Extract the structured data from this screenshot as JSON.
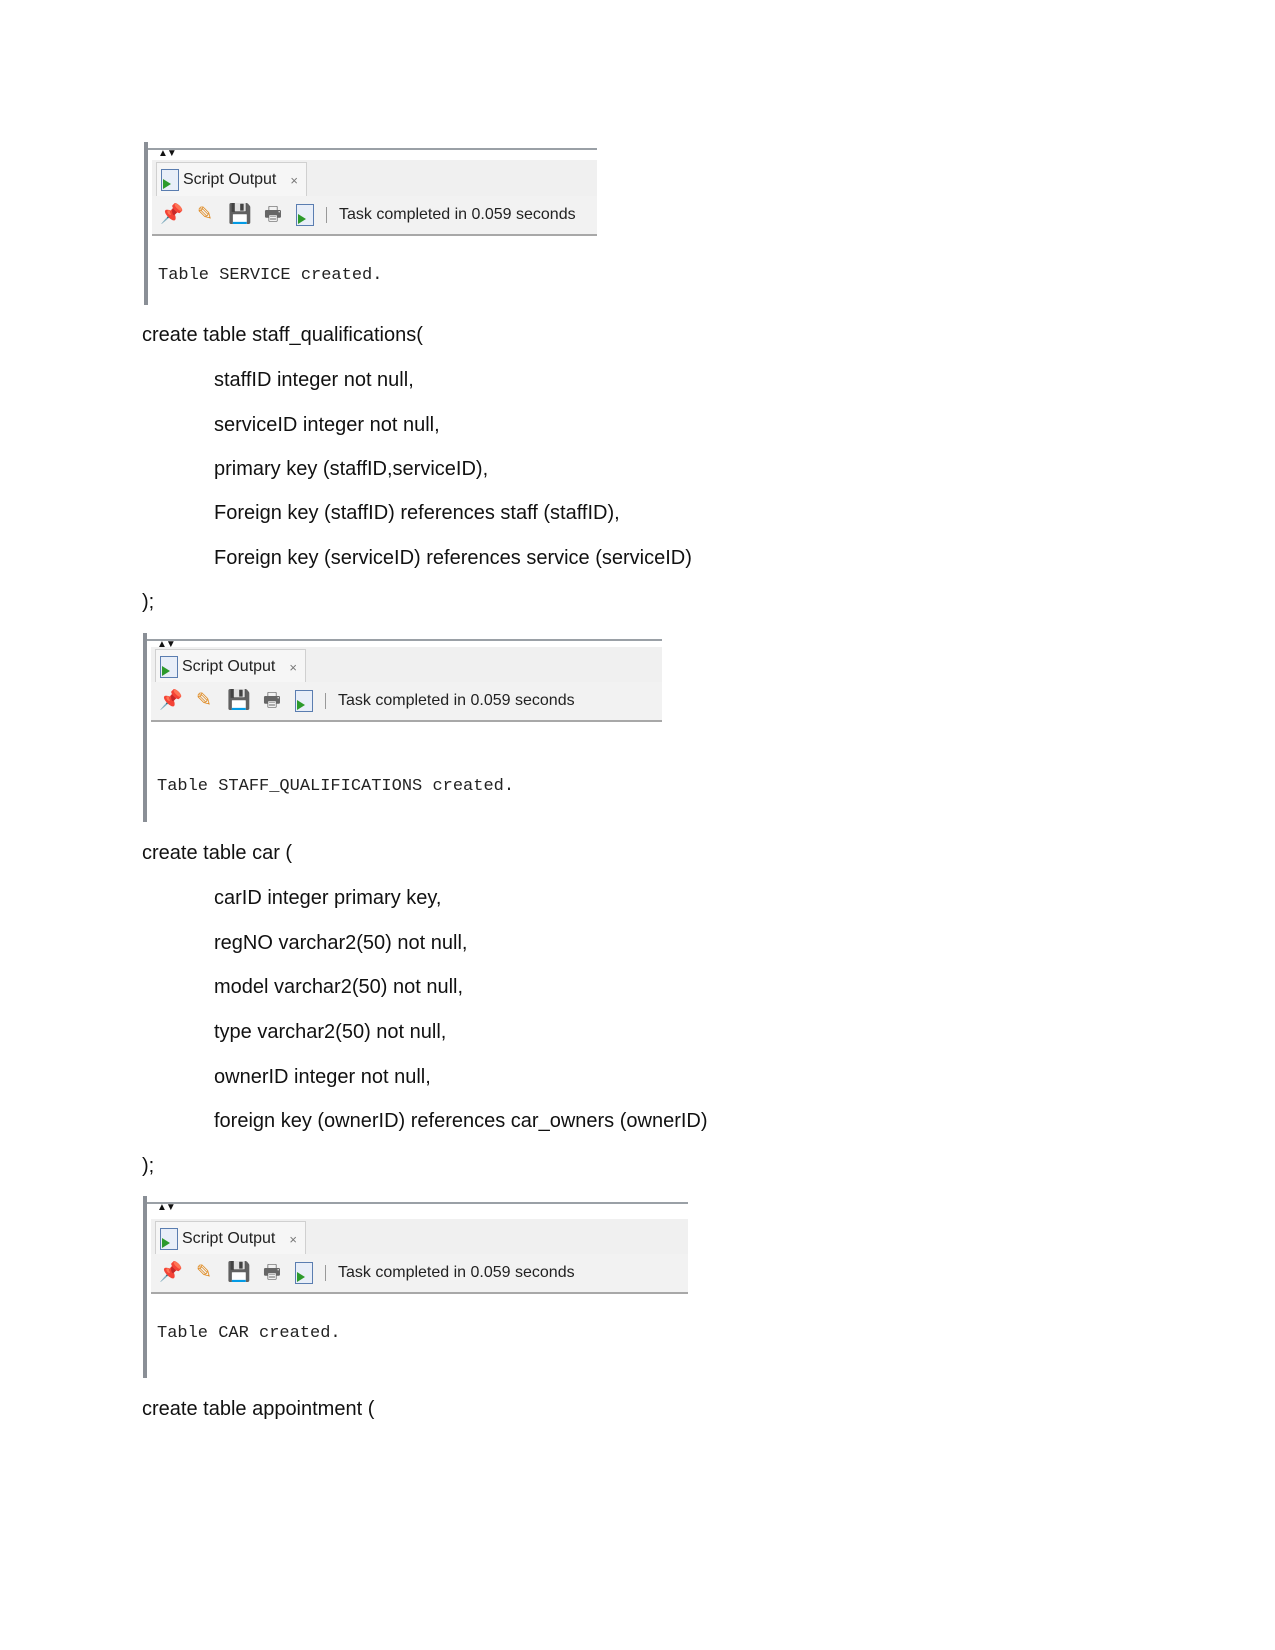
{
  "panel": {
    "tab_label": "Script Output",
    "close": "×",
    "arrows": "▲▼",
    "status": "Task completed in 0.059 seconds",
    "icons": [
      "pin-icon",
      "eraser-icon",
      "save-icon",
      "print-icon",
      "run-script-icon"
    ]
  },
  "outputs": [
    "Table SERVICE created.",
    "Table STAFF_QUALIFICATIONS created.",
    "Table CAR created."
  ],
  "sql": {
    "staff_qualifications": [
      "create table staff_qualifications(",
      "staffID integer not null,",
      "serviceID integer not null,",
      "primary key (staffID,serviceID),",
      "Foreign key (staffID) references staff (staffID),",
      "Foreign key (serviceID) references service (serviceID)",
      ");"
    ],
    "car": [
      "create table car (",
      "carID integer primary key,",
      "regNO varchar2(50) not null,",
      "model varchar2(50) not null,",
      "type varchar2(50) not null,",
      "ownerID integer not null,",
      "foreign key (ownerID) references car_owners (ownerID)",
      ");"
    ],
    "appointment": [
      "create table appointment ("
    ]
  }
}
